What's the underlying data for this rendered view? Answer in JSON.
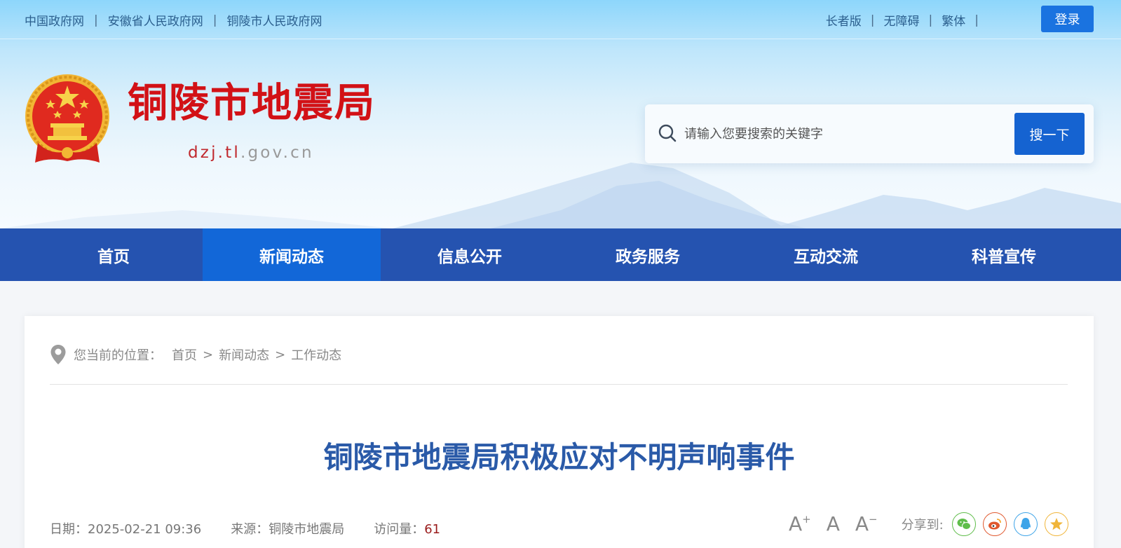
{
  "topbar": {
    "links": [
      "中国政府网",
      "安徽省人民政府网",
      "铜陵市人民政府网"
    ],
    "separator": "|",
    "right_links": [
      "长者版",
      "无障碍",
      "繁体"
    ],
    "login": "登录"
  },
  "site": {
    "title": "铜陵市地震局",
    "domain_red": "dzj.tl",
    "domain_gray": ".gov.cn"
  },
  "search": {
    "placeholder": "请输入您要搜索的关键字",
    "button": "搜一下"
  },
  "nav": {
    "items": [
      "首页",
      "新闻动态",
      "信息公开",
      "政务服务",
      "互动交流",
      "科普宣传"
    ],
    "active_index": 1
  },
  "breadcrumb": {
    "label": "您当前的位置：",
    "items": [
      "首页",
      "新闻动态",
      "工作动态"
    ],
    "separator": ">"
  },
  "article": {
    "title": "铜陵市地震局积极应对不明声响事件",
    "date_label": "日期：",
    "date": "2025-02-21 09:36",
    "source_label": "来源：",
    "source": "铜陵市地震局",
    "views_label": "访问量：",
    "views": "61"
  },
  "tools": {
    "font_larger": "A",
    "font_larger_mark": "+",
    "font_normal": "A",
    "font_smaller": "A",
    "font_smaller_mark": "−",
    "share_label": "分享到:"
  },
  "colors": {
    "nav_bg": "#2553b0",
    "nav_active": "#1267d8",
    "title_red": "#d21116",
    "article_title": "#2a5aa8",
    "button_blue": "#1563d1"
  },
  "icons": [
    "national-emblem-icon",
    "search-icon",
    "location-pin-icon",
    "wechat-icon",
    "weibo-icon",
    "qq-icon",
    "qzone-icon"
  ]
}
